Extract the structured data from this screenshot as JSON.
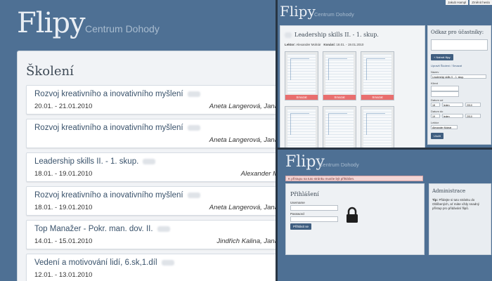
{
  "left": {
    "brand": "Flipy",
    "subtitle": "Centrum Dohody",
    "section_title": "Školení",
    "courses": [
      {
        "name": "Rozvoj kreativního a inovativního myšlení",
        "date": "20.01. - 21.01.2010",
        "lecturer": "Aneta Langerová, Jana"
      },
      {
        "name": "Rozvoj kreativního a inovativního myšlení",
        "date": "",
        "lecturer": "Aneta Langerová, Jana"
      },
      {
        "name": "Leadership skills II. - 1. skup.",
        "date": "18.01. - 19.01.2010",
        "lecturer": "Alexander M"
      },
      {
        "name": "Rozvoj kreativního a inovativního myšlení",
        "date": "18.01. - 19.01.2010",
        "lecturer": "Aneta Langerová, Jana"
      },
      {
        "name": "Top Manažer - Pokr. man. dov. II.",
        "date": "14.01. - 15.01.2010",
        "lecturer": "Jindřich Kalina, Jana"
      },
      {
        "name": "Vedení a motivování lidí, 6.sk,1.díl",
        "date": "12.01. - 13.01.2010",
        "lecturer": ""
      }
    ]
  },
  "topright": {
    "brand": "Flipy",
    "subtitle": "Centrum Dohody",
    "user_links": [
      "Jakub Hampl",
      "Změnit heslo"
    ],
    "course_title": "Leadership skills II. - 1. skup.",
    "meta_lektor_label": "Lektor:",
    "meta_lektor": "Alexander Molnár",
    "meta_konani_label": "Konání:",
    "meta_konani": "18.01. - 19.01.2010",
    "delete_label": "Smazat",
    "side_title": "Odkaz pro účastníky:",
    "upload_button": "+ Nahrát flipy",
    "edit_link": "Upravit Školení / Smazat",
    "field_nazev": "Název",
    "nazev_value": "Leadership skills II. - 1. skup.",
    "field_klient": "Klient",
    "field_datum_od": "Datum od",
    "field_datum_do": "Datum do",
    "field_lektor": "Lektor",
    "day_od": "18",
    "month_od": "leden",
    "year_od": "2010",
    "day_do": "19",
    "month_do": "leden",
    "year_do": "2010",
    "lektor_value": "Alexander Molnár",
    "save_button": "Uložit"
  },
  "botright": {
    "brand": "Flipy",
    "subtitle": "Centrum Dohody",
    "warning": "K přístupu na tuto stránku musíte být přihlášen.",
    "login_title": "Přihlášení",
    "username_label": "Username",
    "password_label": "Password",
    "login_button": "Přihlásit se",
    "admin_title": "Administrace",
    "tip_label": "Tip:",
    "tip_text": "Přidejte si tuto stránku do Oblíbených, ať máte vždy snadný přístup pro přidávání flipů."
  }
}
